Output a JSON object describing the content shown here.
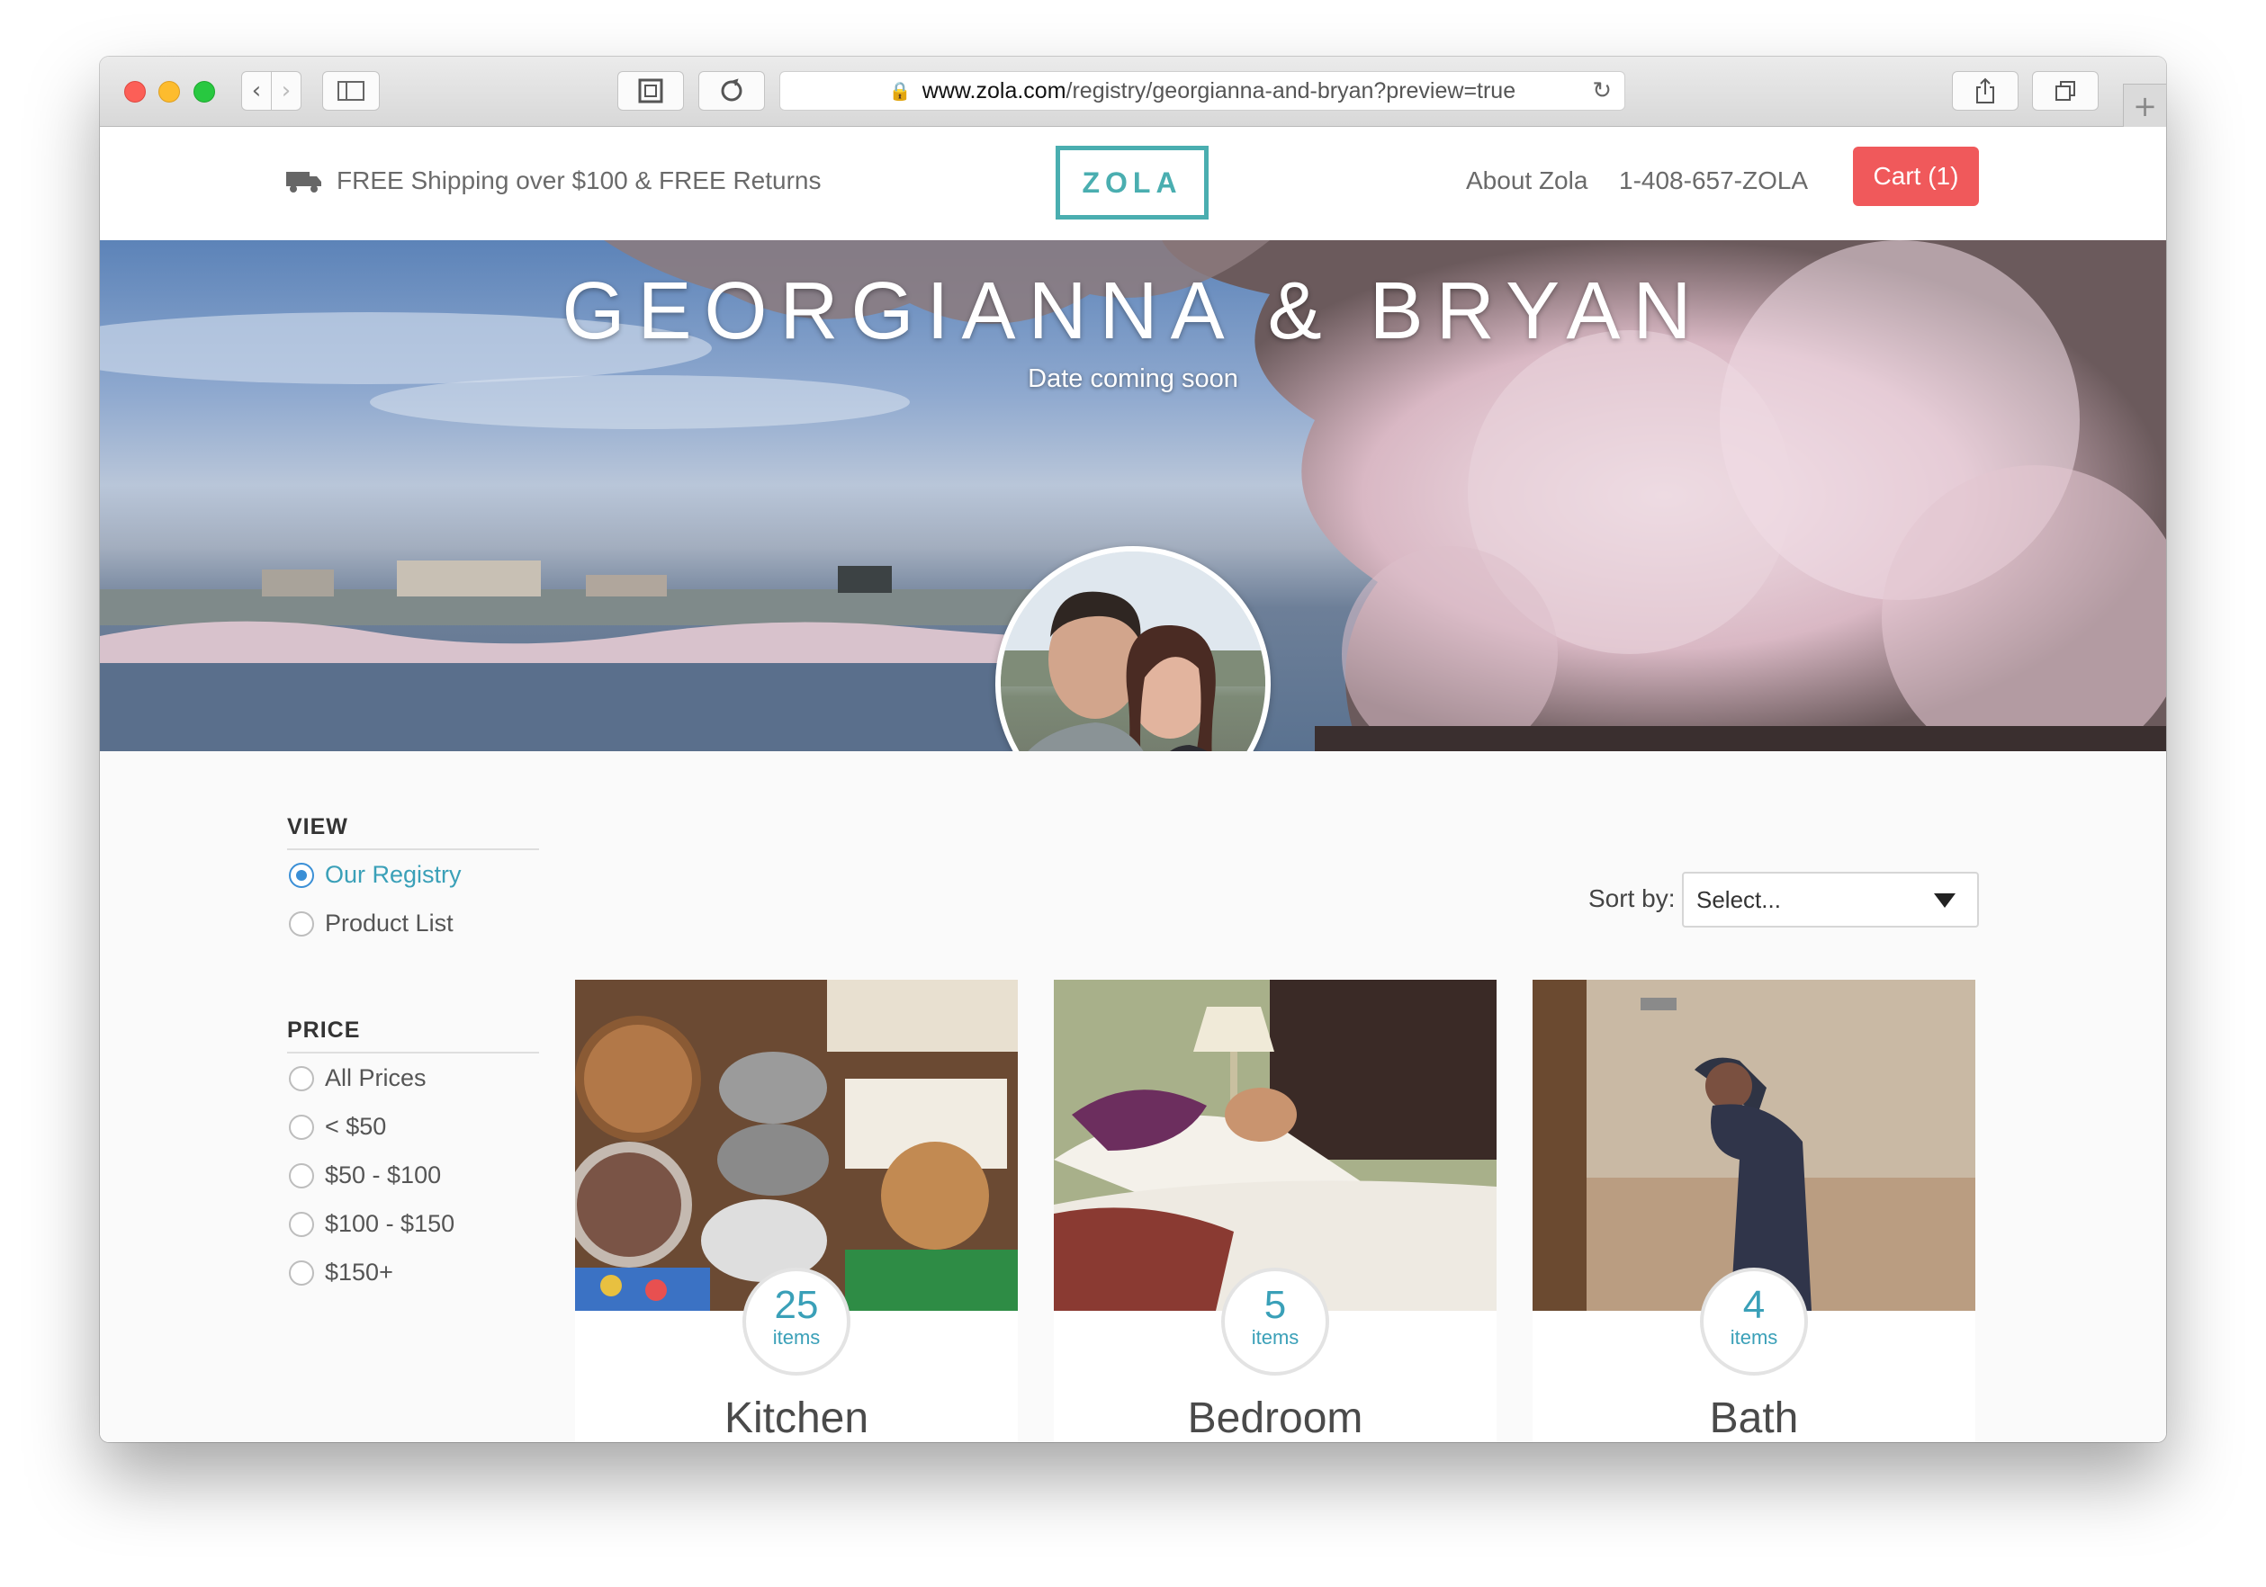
{
  "browser": {
    "url_domain": "www.zola.com",
    "url_path": "/registry/georgianna-and-bryan?preview=true"
  },
  "header": {
    "shipping": "FREE Shipping over $100 & FREE Returns",
    "logo": "ZOLA",
    "about": "About Zola",
    "phone": "1-408-657-ZOLA",
    "cart": "Cart (1)"
  },
  "hero": {
    "title": "GEORGIANNA & BRYAN",
    "subtitle": "Date coming soon"
  },
  "filters": {
    "view_heading": "VIEW",
    "view_options": [
      "Our Registry",
      "Product List"
    ],
    "view_selected": "Our Registry",
    "price_heading": "PRICE",
    "price_options": [
      "All Prices",
      "< $50",
      "$50 - $100",
      "$100 - $150",
      "$150+"
    ]
  },
  "sort": {
    "label": "Sort by:",
    "value": "Select..."
  },
  "categories": [
    {
      "count": "25",
      "unit": "items",
      "name": "Kitchen"
    },
    {
      "count": "5",
      "unit": "items",
      "name": "Bedroom"
    },
    {
      "count": "4",
      "unit": "items",
      "name": "Bath"
    }
  ],
  "colors": {
    "accent": "#4aaeb0",
    "cart": "#f0595b",
    "radio_selected": "#3a8fd6"
  }
}
